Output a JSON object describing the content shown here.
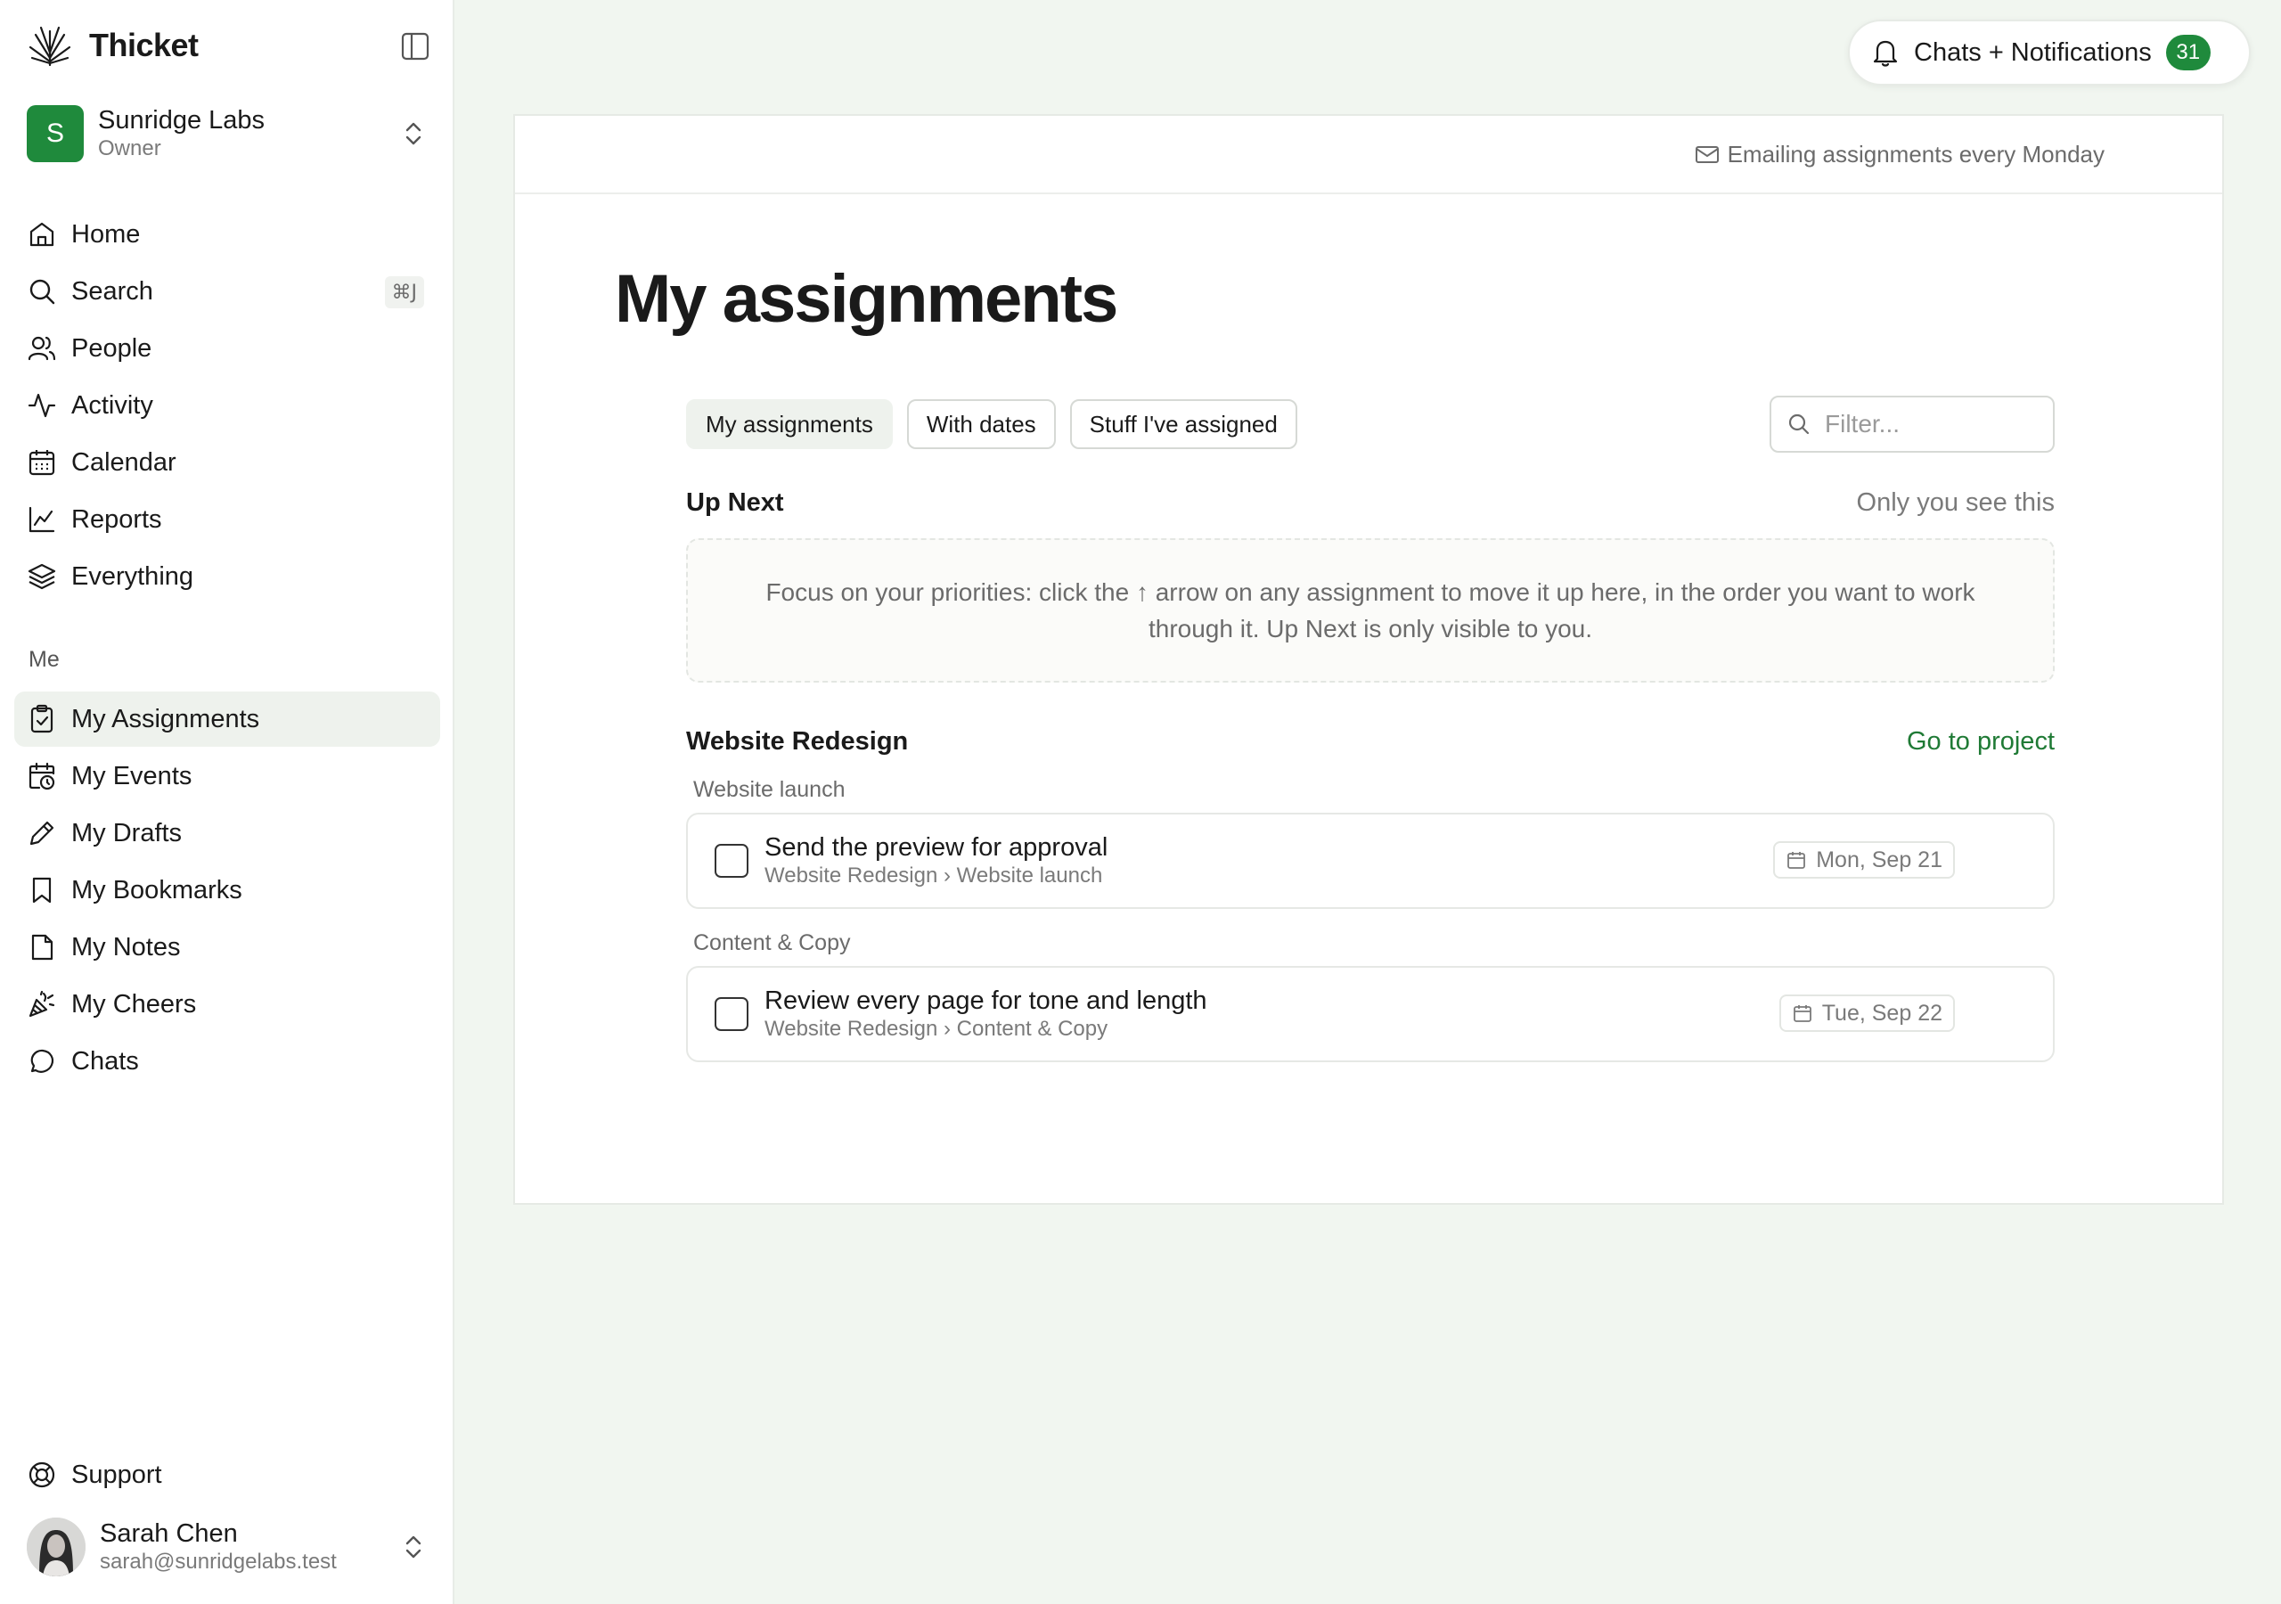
{
  "brand": {
    "name": "Thicket"
  },
  "workspace": {
    "initial": "S",
    "name": "Sunridge Labs",
    "role": "Owner"
  },
  "nav": [
    {
      "label": "Home",
      "icon": "home-icon"
    },
    {
      "label": "Search",
      "icon": "search-icon",
      "shortcut": "⌘J"
    },
    {
      "label": "People",
      "icon": "people-icon"
    },
    {
      "label": "Activity",
      "icon": "activity-icon"
    },
    {
      "label": "Calendar",
      "icon": "calendar-icon"
    },
    {
      "label": "Reports",
      "icon": "chart-icon"
    },
    {
      "label": "Everything",
      "icon": "layers-icon"
    }
  ],
  "me_section": {
    "label": "Me",
    "items": [
      {
        "label": "My Assignments",
        "icon": "clipboard-check-icon",
        "active": true
      },
      {
        "label": "My Events",
        "icon": "calendar-clock-icon"
      },
      {
        "label": "My Drafts",
        "icon": "pencil-icon"
      },
      {
        "label": "My Bookmarks",
        "icon": "bookmark-icon"
      },
      {
        "label": "My Notes",
        "icon": "note-icon"
      },
      {
        "label": "My Cheers",
        "icon": "party-icon"
      },
      {
        "label": "Chats",
        "icon": "chat-icon"
      }
    ]
  },
  "support": {
    "label": "Support"
  },
  "user": {
    "name": "Sarah Chen",
    "email": "sarah@sunridgelabs.test"
  },
  "notifications": {
    "label": "Chats + Notifications",
    "count": "31"
  },
  "header_note": "Emailing assignments every Monday",
  "page_title": "My assignments",
  "tabs": [
    {
      "label": "My assignments",
      "active": true
    },
    {
      "label": "With dates"
    },
    {
      "label": "Stuff I've assigned"
    }
  ],
  "filter": {
    "placeholder": "Filter...",
    "value": ""
  },
  "up_next": {
    "title": "Up Next",
    "meta": "Only you see this",
    "empty_text": "Focus on your priorities: click the ↑ arrow on any assignment to move it up here, in the order you want to work through it. Up Next is only visible to you."
  },
  "project": {
    "name": "Website Redesign",
    "link": "Go to project",
    "groups": [
      {
        "label": "Website launch",
        "tasks": [
          {
            "title": "Send the preview for approval",
            "path": "Website Redesign › Website launch",
            "due": "Mon, Sep 21"
          }
        ]
      },
      {
        "label": "Content & Copy",
        "tasks": [
          {
            "title": "Review every page for tone and length",
            "path": "Website Redesign › Content & Copy",
            "due": "Tue, Sep 22"
          }
        ]
      }
    ]
  },
  "colors": {
    "accent": "#1f8a3c",
    "link": "#1f7a35",
    "background": "#f1f6f0"
  }
}
